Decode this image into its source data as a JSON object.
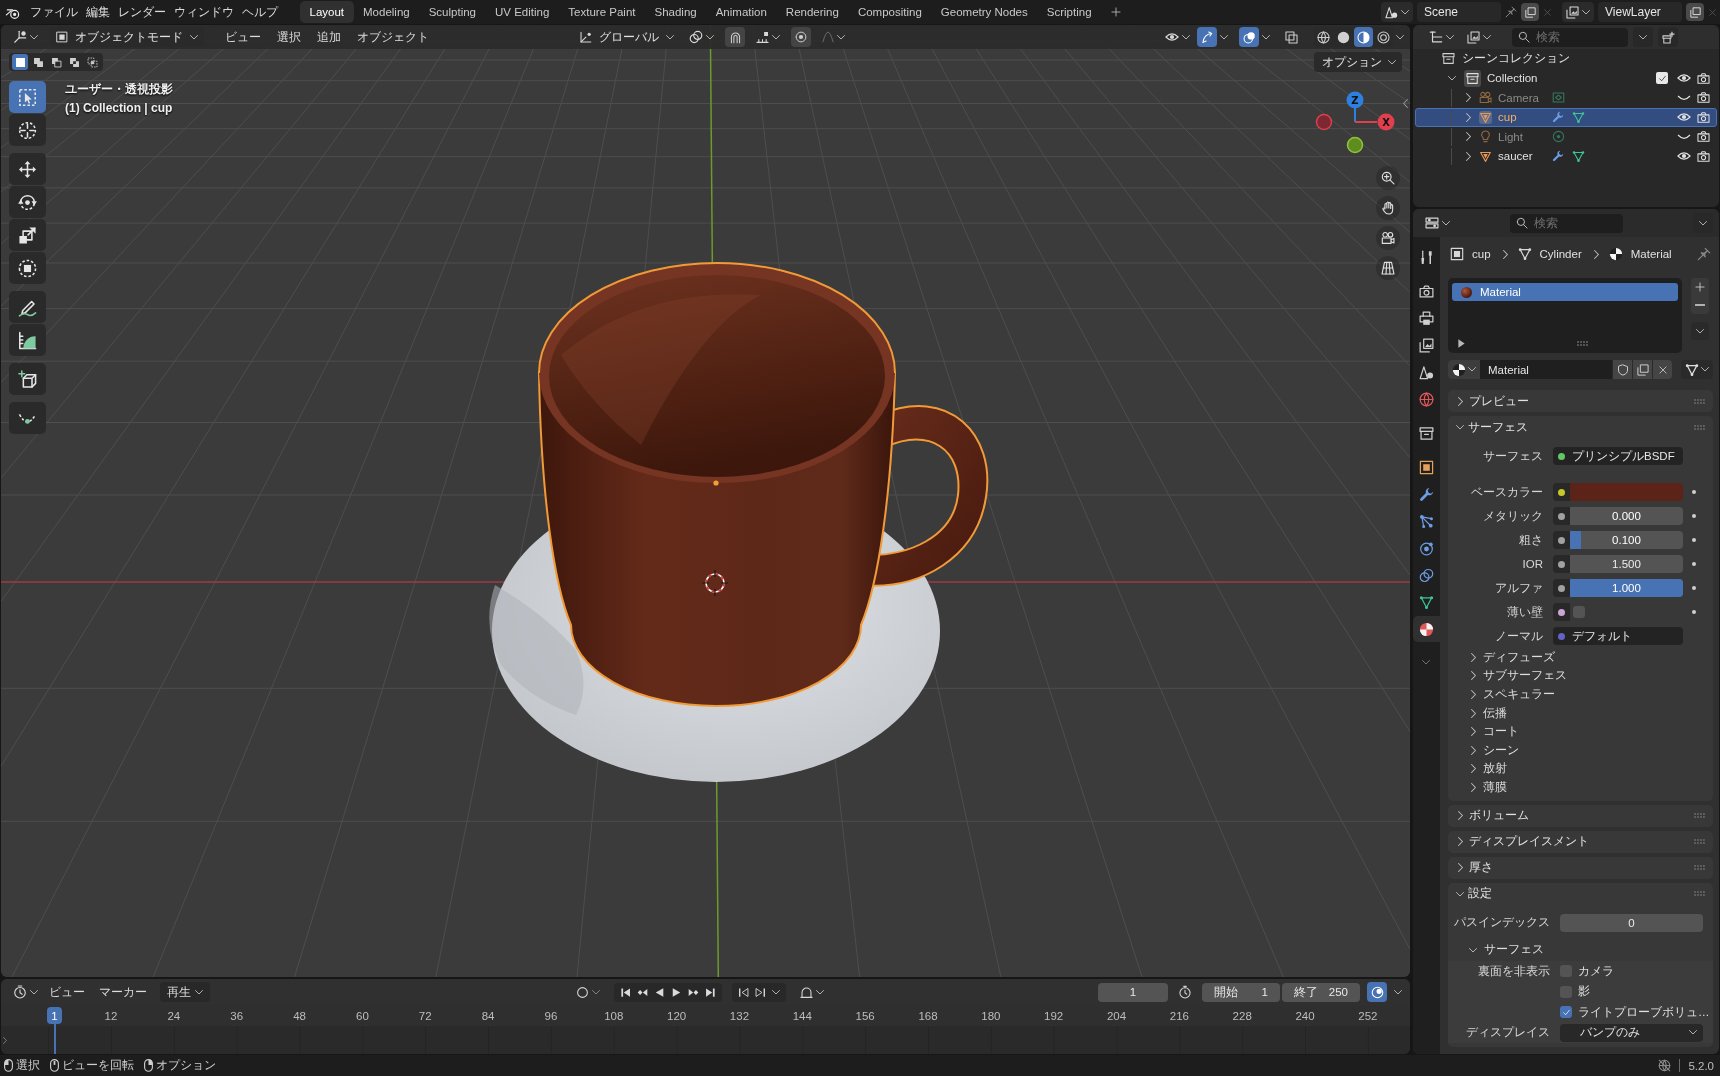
{
  "top_bar": {
    "menus": [
      "ファイル",
      "編集",
      "レンダー",
      "ウィンドウ",
      "ヘルプ"
    ],
    "workspaces": [
      {
        "label": "Layout",
        "selected": true
      },
      {
        "label": "Modeling",
        "selected": false
      },
      {
        "label": "Sculpting",
        "selected": false
      },
      {
        "label": "UV Editing",
        "selected": false
      },
      {
        "label": "Texture Paint",
        "selected": false
      },
      {
        "label": "Shading",
        "selected": false
      },
      {
        "label": "Animation",
        "selected": false
      },
      {
        "label": "Rendering",
        "selected": false
      },
      {
        "label": "Compositing",
        "selected": false
      },
      {
        "label": "Geometry Nodes",
        "selected": false
      },
      {
        "label": "Scripting",
        "selected": false
      }
    ],
    "scene": "Scene",
    "view_layer": "ViewLayer"
  },
  "viewport": {
    "mode": "オブジェクトモード",
    "menus": [
      "ビュー",
      "選択",
      "追加",
      "オブジェクト"
    ],
    "orientation": "グローバル",
    "toggles": [
      {
        "kind": "gizmos",
        "on": true
      },
      {
        "kind": "overlays",
        "on": true
      },
      {
        "kind": "xray",
        "on": false
      }
    ],
    "shading": [
      {
        "kind": "wireframe",
        "selected": false
      },
      {
        "kind": "solid",
        "selected": false
      },
      {
        "kind": "material",
        "selected": true
      },
      {
        "kind": "rendered",
        "selected": false
      }
    ],
    "selection_modes": [
      {
        "kind": "set",
        "selected": true
      },
      {
        "kind": "extend",
        "selected": false
      },
      {
        "kind": "subtract",
        "selected": false
      },
      {
        "kind": "invert",
        "selected": false
      },
      {
        "kind": "intersect",
        "selected": false
      }
    ],
    "options": "オプション",
    "view_name": "ユーザー・透視投影",
    "object_info": "(1) Collection | cup",
    "tool_groups": [
      {
        "tools": [
          {
            "kind": "select",
            "selected": true
          },
          {
            "kind": "cursor",
            "selected": false
          }
        ]
      },
      {
        "tools": [
          {
            "kind": "move",
            "selected": false
          },
          {
            "kind": "rotate",
            "selected": false
          },
          {
            "kind": "scale",
            "selected": false
          },
          {
            "kind": "transform",
            "selected": false
          }
        ]
      },
      {
        "tools": [
          {
            "kind": "annotate",
            "selected": false
          },
          {
            "kind": "measure",
            "selected": false
          }
        ]
      },
      {
        "tools": [
          {
            "kind": "add_cube",
            "selected": false
          }
        ]
      },
      {
        "tools": [
          {
            "kind": "curve",
            "selected": false
          }
        ]
      }
    ],
    "gizmo": {
      "z": "Z",
      "x": "X"
    }
  },
  "timeline": {
    "menus": [
      {
        "label": "ビュー",
        "dropdown": false
      },
      {
        "label": "マーカー",
        "dropdown": false
      },
      {
        "label": "再生",
        "dropdown": true
      }
    ],
    "auto_keying": {
      "on": false
    },
    "current_frame": "1",
    "preview_range": {
      "on": false
    },
    "start": {
      "label": "開始",
      "value": "1"
    },
    "end": {
      "label": "終了",
      "value": "250"
    },
    "snapping": {
      "on": true
    },
    "playhead": "1",
    "ticks": [
      "12",
      "24",
      "36",
      "48",
      "60",
      "72",
      "84",
      "96",
      "108",
      "120",
      "132",
      "144",
      "156",
      "168",
      "180",
      "192",
      "204",
      "216",
      "228",
      "240",
      "252"
    ]
  },
  "status_bar": {
    "hints": [
      {
        "kind": "left_click",
        "label": "選択"
      },
      {
        "kind": "middle_click",
        "label": "ビューを回転"
      },
      {
        "kind": "right_click",
        "label": "オプション"
      }
    ],
    "version": "5.2.0"
  },
  "outliner": {
    "search_placeholder": "検索",
    "root": "シーンコレクション",
    "collections": [
      {
        "label": "Collection",
        "expanded": true,
        "checked": true,
        "visible": true,
        "children": [
          {
            "kind": "camera",
            "label": "Camera",
            "expanded": false,
            "selected": false,
            "visible": false,
            "modifiers": false
          },
          {
            "kind": "mesh",
            "label": "cup",
            "expanded": false,
            "selected": true,
            "visible": true,
            "modifiers": true
          },
          {
            "kind": "light",
            "label": "Light",
            "expanded": false,
            "selected": false,
            "visible": false,
            "modifiers": false
          },
          {
            "kind": "mesh",
            "label": "saucer",
            "expanded": false,
            "selected": false,
            "visible": true,
            "modifiers": true
          }
        ]
      }
    ]
  },
  "properties": {
    "search_placeholder": "検索",
    "tab_groups": [
      [
        {
          "kind": "tool",
          "selected": false
        }
      ],
      [
        {
          "kind": "render",
          "selected": false
        },
        {
          "kind": "output",
          "selected": false
        },
        {
          "kind": "view_layer",
          "selected": false
        },
        {
          "kind": "scene",
          "selected": false
        },
        {
          "kind": "world",
          "selected": false
        }
      ],
      [
        {
          "kind": "collection",
          "selected": false
        }
      ],
      [
        {
          "kind": "object",
          "selected": false
        },
        {
          "kind": "modifiers",
          "selected": false
        },
        {
          "kind": "particles",
          "selected": false
        },
        {
          "kind": "physics",
          "selected": false
        },
        {
          "kind": "constraints",
          "selected": false
        },
        {
          "kind": "data",
          "selected": false
        },
        {
          "kind": "material",
          "selected": true
        }
      ]
    ],
    "breadcrumb": [
      {
        "kind": "object",
        "label": "cup"
      },
      {
        "kind": "mesh",
        "label": "Cylinder"
      },
      {
        "kind": "material",
        "label": "Material"
      }
    ],
    "material_slots": [
      {
        "label": "Material",
        "selected": true
      }
    ],
    "material_name": "Material",
    "panels": [
      {
        "title": "プレビュー",
        "expanded": false
      },
      {
        "title": "サーフェス",
        "expanded": true,
        "rows": [
          {
            "kind": "link",
            "label": "サーフェス",
            "color": "#63c763",
            "value": "プリンシプルBSDF"
          },
          {
            "kind": "color",
            "label": "ベースカラー",
            "color": "#c7c729",
            "swatch": {
              "color": "#5c2419"
            }
          },
          {
            "kind": "slider",
            "label": "メタリック",
            "color": "#a1a1a1",
            "value": "0.000"
          },
          {
            "kind": "slider",
            "label": "粗さ",
            "color": "#a1a1a1",
            "value": "0.100",
            "level": 0.1
          },
          {
            "kind": "number",
            "label": "IOR",
            "color": "#a1a1a1",
            "value": "1.500"
          },
          {
            "kind": "slider",
            "label": "アルファ",
            "color": "#a1a1a1",
            "value": "1.000",
            "level": 1
          },
          {
            "kind": "toggle",
            "label": "薄い壁",
            "color": "#cca6d6",
            "checked": false
          },
          {
            "kind": "link",
            "label": "ノーマル",
            "color": "#6363c7",
            "value": "デフォルト"
          }
        ],
        "subpanels": [
          {
            "title": "ディフューズ",
            "expanded": false
          },
          {
            "title": "サブサーフェス",
            "expanded": false
          },
          {
            "title": "スペキュラー",
            "expanded": false
          },
          {
            "title": "伝播",
            "expanded": false
          },
          {
            "title": "コート",
            "expanded": false
          },
          {
            "title": "シーン",
            "expanded": false
          },
          {
            "title": "放射",
            "expanded": false
          },
          {
            "title": "薄膜",
            "expanded": false
          }
        ]
      },
      {
        "title": "ボリューム",
        "expanded": false
      },
      {
        "title": "ディスプレイスメント",
        "expanded": false
      },
      {
        "title": "厚さ",
        "expanded": false
      },
      {
        "title": "設定",
        "expanded": true,
        "rows": [
          {
            "kind": "field",
            "label": "パスインデックス",
            "value": "0"
          }
        ],
        "subpanels": [
          {
            "title": "サーフェス",
            "expanded": true,
            "rows": [
              {
                "kind": "option",
                "label": "裏面を非表示",
                "option": "カメラ",
                "checked": false
              },
              {
                "kind": "option",
                "option": "影",
                "checked": false
              },
              {
                "kind": "option",
                "option": "ライトプローブボリュ…",
                "checked": true
              },
              {
                "kind": "dropdown",
                "label": "ディスプレイス",
                "value": "バンプのみ"
              }
            ]
          }
        ]
      }
    ]
  }
}
